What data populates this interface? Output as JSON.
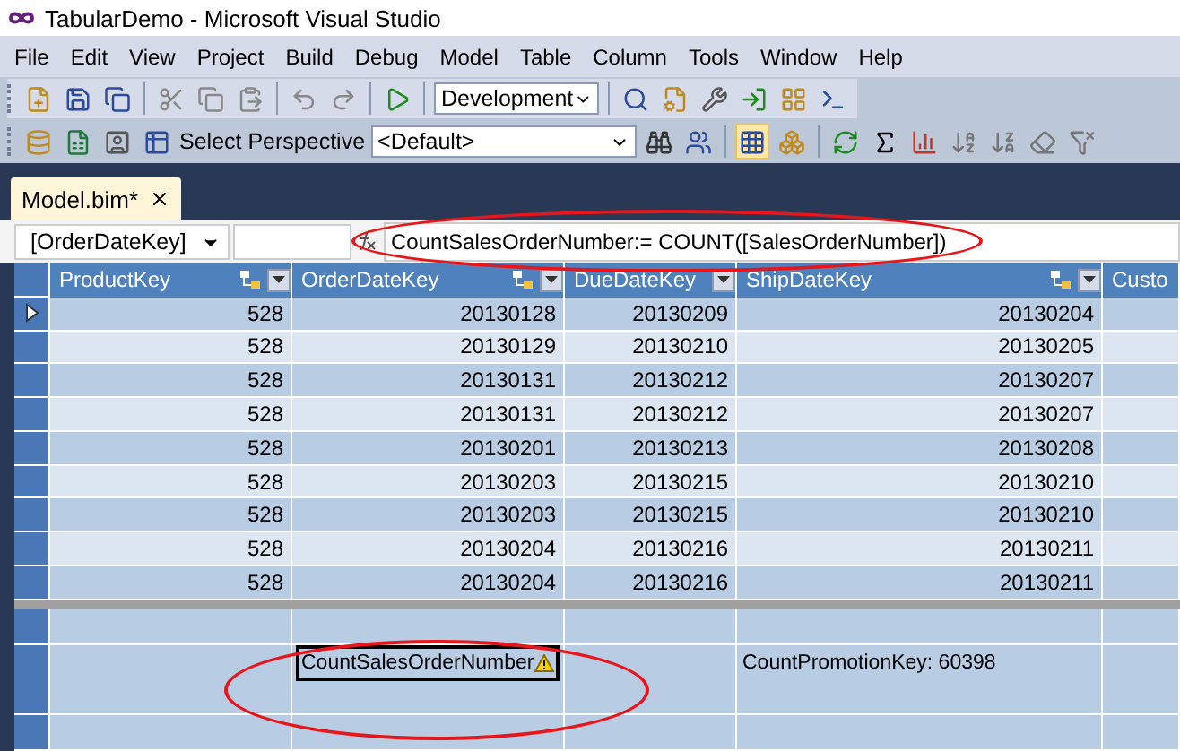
{
  "window": {
    "title": "TabularDemo - Microsoft Visual Studio"
  },
  "menu": [
    "File",
    "Edit",
    "View",
    "Project",
    "Build",
    "Debug",
    "Model",
    "Table",
    "Column",
    "Tools",
    "Window",
    "Help"
  ],
  "toolbar": {
    "configuration": "Development"
  },
  "model_toolbar": {
    "label": "Select Perspective",
    "perspective": "<Default>",
    "views": [
      {
        "selected": true
      },
      {
        "selected": false
      }
    ]
  },
  "tabs": [
    {
      "label": "Model.bim*",
      "selected": true
    }
  ],
  "formula_bar": {
    "column": "[OrderDateKey]",
    "formula": "CountSalesOrderNumber:= COUNT([SalesOrderNumber])"
  },
  "table": {
    "columns": [
      {
        "name": "ProductKey",
        "related": true
      },
      {
        "name": "OrderDateKey",
        "related": true,
        "measure": {
          "text": "CountSalesOrderNumber",
          "selected": true,
          "warning": true
        }
      },
      {
        "name": "DueDateKey",
        "related": false
      },
      {
        "name": "ShipDateKey",
        "related": true,
        "measure": {
          "text": "CountPromotionKey: 60398",
          "selected": false,
          "warning": false
        }
      },
      {
        "name": "Custo",
        "related": false
      }
    ],
    "rows": [
      {
        "current": true,
        "cells": [
          "528",
          "20130128",
          "20130209",
          "20130204"
        ]
      },
      {
        "current": false,
        "cells": [
          "528",
          "20130129",
          "20130210",
          "20130205"
        ]
      },
      {
        "current": false,
        "cells": [
          "528",
          "20130131",
          "20130212",
          "20130207"
        ]
      },
      {
        "current": false,
        "cells": [
          "528",
          "20130131",
          "20130212",
          "20130207"
        ]
      },
      {
        "current": false,
        "cells": [
          "528",
          "20130201",
          "20130213",
          "20130208"
        ]
      },
      {
        "current": false,
        "cells": [
          "528",
          "20130203",
          "20130215",
          "20130210"
        ]
      },
      {
        "current": false,
        "cells": [
          "528",
          "20130203",
          "20130215",
          "20130210"
        ]
      },
      {
        "current": false,
        "cells": [
          "528",
          "20130204",
          "20130216",
          "20130211"
        ]
      },
      {
        "current": false,
        "cells": [
          "528",
          "20130204",
          "20130216",
          "20130211"
        ]
      }
    ]
  }
}
